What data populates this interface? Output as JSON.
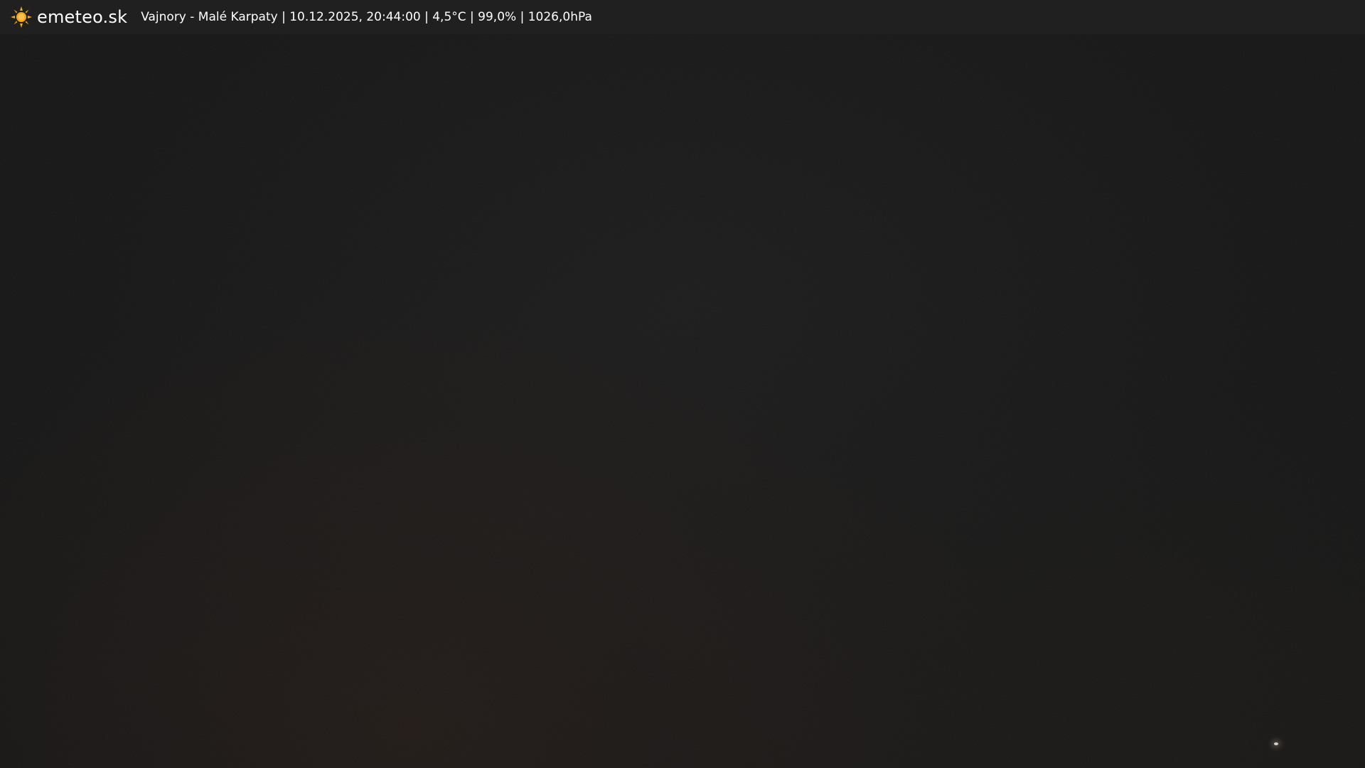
{
  "header": {
    "brand": "emeteo.sk",
    "logo_icon": "sun-icon",
    "station_info": "Vajnory - Malé Karpaty | 10.12.2025, 20:44:00 | 4,5°C | 99,0% | 1026,0hPa"
  },
  "colors": {
    "header_bg": "#202020",
    "sun": "#f5a623",
    "image_bg": "#151515"
  }
}
